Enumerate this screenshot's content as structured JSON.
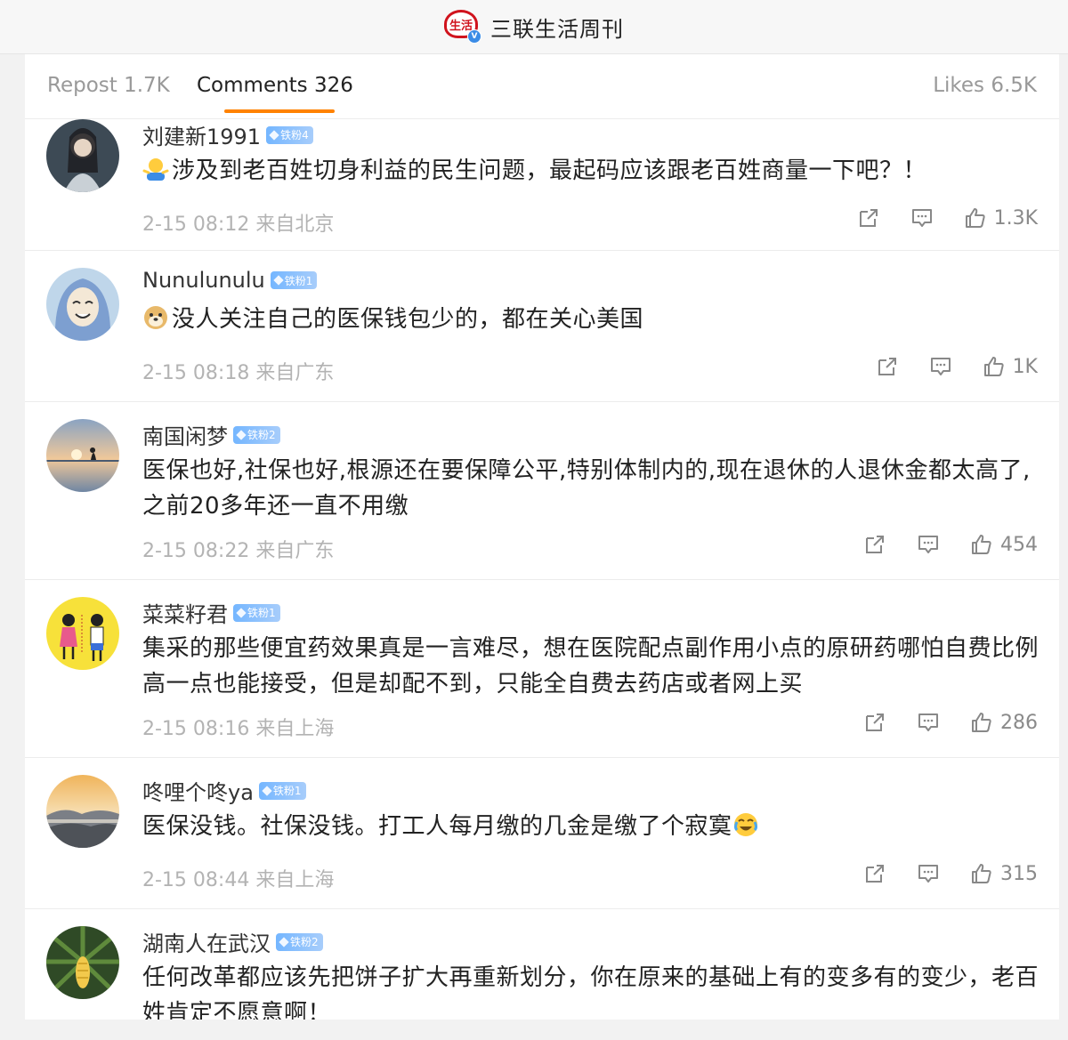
{
  "header": {
    "logo_text": "生活",
    "account_name": "三联生活周刊"
  },
  "tabs": {
    "repost": "Repost 1.7K",
    "comments": "Comments 326",
    "likes": "Likes 6.5K"
  },
  "comments": [
    {
      "username": "刘建新1991",
      "fan_badge": "铁粉4",
      "emoji": "shrug-emoji",
      "text": "涉及到老百姓切身利益的民生问题，最起码应该跟老百姓商量一下吧？！",
      "meta": "2-15 08:12 来自北京",
      "likes": "1.3K"
    },
    {
      "username": "Nunulunulu",
      "fan_badge": "铁粉1",
      "emoji": "doge-emoji",
      "text": "没人关注自己的医保钱包少的，都在关心美国",
      "meta": "2-15 08:18 来自广东",
      "likes": "1K"
    },
    {
      "username": "南国闲梦",
      "fan_badge": "铁粉2",
      "text": "医保也好,社保也好,根源还在要保障公平,特别体制内的,现在退休的人退休金都太高了,之前20多年还一直不用缴",
      "meta": "2-15 08:22 来自广东",
      "likes": "454"
    },
    {
      "username": "菜菜籽君",
      "fan_badge": "铁粉1",
      "text": "集采的那些便宜药效果真是一言难尽，想在医院配点副作用小点的原研药哪怕自费比例高一点也能接受，但是却配不到，只能全自费去药店或者网上买",
      "meta": "2-15 08:16 来自上海",
      "likes": "286"
    },
    {
      "username": "咚哩个咚ya",
      "fan_badge": "铁粉1",
      "text": "医保没钱。社保没钱。打工人每月缴的几金是缴了个寂寞",
      "emoji_after": "crying-laughing-emoji",
      "meta": "2-15 08:44 来自上海",
      "likes": "315"
    },
    {
      "username": "湖南人在武汉",
      "fan_badge": "铁粉2",
      "text": "任何改革都应该先把饼子扩大再重新划分，你在原来的基础上有的变多有的变少，老百姓肯定不愿意啊！"
    }
  ],
  "colors": {
    "accent": "#ff8200",
    "badge": "#74b6ff",
    "brand_red": "#d0131d",
    "meta_text": "#b3b3b3"
  }
}
